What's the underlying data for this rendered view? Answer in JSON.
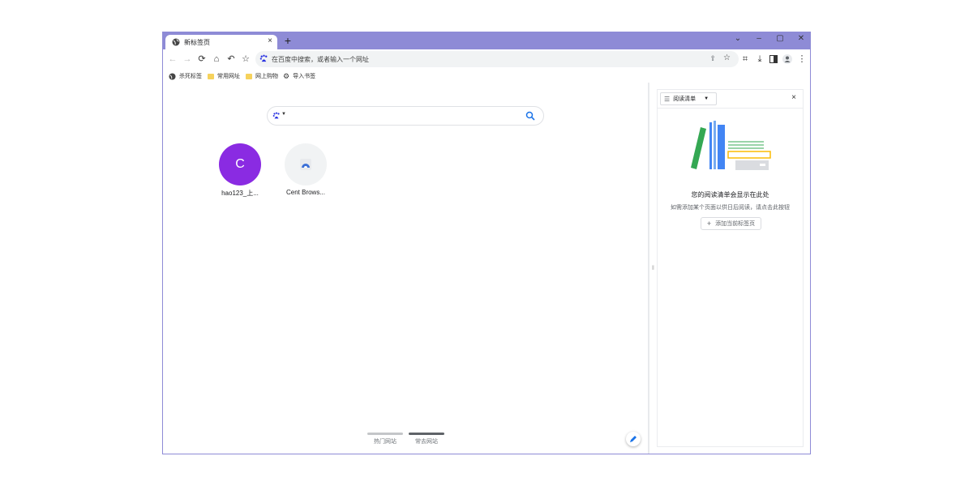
{
  "tab": {
    "title": "新标签页",
    "close": "×"
  },
  "new_tab": "+",
  "window_controls": {
    "dropdown": "⌄",
    "minimize": "–",
    "maximize": "▢",
    "close": "✕"
  },
  "omnibox": {
    "placeholder": "在百度中搜索，或者输入一个网址"
  },
  "bookmarks": [
    {
      "label": "杀死标签",
      "icon": "globe-icon"
    },
    {
      "label": "常用网址",
      "icon": "folder-icon"
    },
    {
      "label": "网上购物",
      "icon": "folder-icon"
    },
    {
      "label": "导入书签",
      "icon": "gear-icon"
    }
  ],
  "shortcuts": [
    {
      "letter": "C",
      "label": "hao123_上...",
      "color": "#8a2be2"
    },
    {
      "letter": "",
      "label": "Cent Brows...",
      "color": "#f1f3f4"
    }
  ],
  "ntp_tabs": {
    "popular": "热门网站",
    "frequent": "常去网站"
  },
  "side_panel": {
    "selector": "阅读清单",
    "close": "×",
    "empty_title": "您的阅读清单会显示在此处",
    "empty_sub": "如需添加某个页面以供日后阅读，请点击此按钮",
    "add_button": "添加当前标签页",
    "add_plus": "+"
  },
  "colors": {
    "accent": "#8e8bd6",
    "brand_purple": "#8a2be2",
    "link_blue": "#1a73e8"
  }
}
